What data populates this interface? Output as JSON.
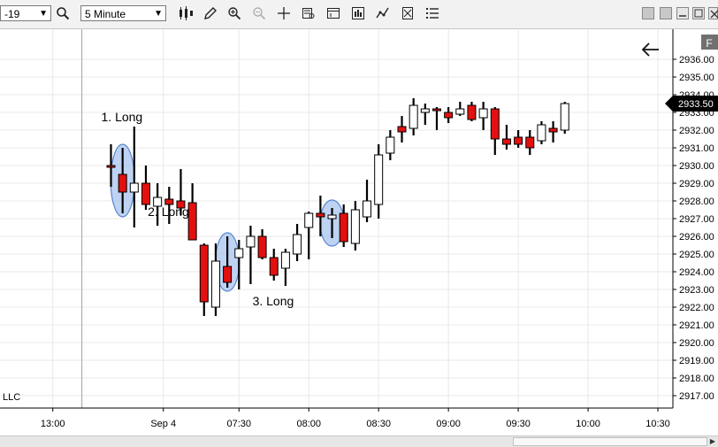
{
  "toolbar": {
    "instrument_value": "-19",
    "interval_value": "5 Minute",
    "icons": [
      "search-icon",
      "bar-type-icon",
      "pencil-icon",
      "zoom-in-icon",
      "zoom-out-icon",
      "crosshair-icon",
      "data-box-icon",
      "chart-properties-icon",
      "strategies-icon",
      "indicators-icon",
      "drawing-tools-icon",
      "list-icon"
    ]
  },
  "panel_label": "F",
  "corner_text": "LLC",
  "price_marker": "2933.50",
  "annotations": [
    {
      "text": "1. Long",
      "bar": 0,
      "price": 2932.5
    },
    {
      "text": "2. Long",
      "bar": 4,
      "price": 2927.15
    },
    {
      "text": "3. Long",
      "bar": 13,
      "price": 2922.1
    }
  ],
  "highlight_bars": [
    1,
    10,
    19
  ],
  "chart_data": {
    "type": "candlestick",
    "y_ticks": [
      "2917.00",
      "2918.00",
      "2919.00",
      "2920.00",
      "2921.00",
      "2922.00",
      "2923.00",
      "2924.00",
      "2925.00",
      "2926.00",
      "2927.00",
      "2928.00",
      "2929.00",
      "2930.00",
      "2931.00",
      "2932.00",
      "2933.00",
      "2934.00",
      "2935.00",
      "2936.00"
    ],
    "ylim": [
      2916.3,
      2937.7
    ],
    "x_ticks": [
      {
        "label": "13:00",
        "bar": -5
      },
      {
        "label": "Sep 4",
        "bar": 4.5
      },
      {
        "label": "07:30",
        "bar": 11
      },
      {
        "label": "08:00",
        "bar": 17
      },
      {
        "label": "08:30",
        "bar": 23
      },
      {
        "label": "09:00",
        "bar": 29
      },
      {
        "label": "09:30",
        "bar": 35
      },
      {
        "label": "10:00",
        "bar": 41
      },
      {
        "label": "10:30",
        "bar": 47
      }
    ],
    "session_break_bar": -2.5,
    "candles": [
      {
        "o": 2930.0,
        "h": 2931.2,
        "l": 2928.8,
        "c": 2929.9
      },
      {
        "o": 2929.5,
        "h": 2931.0,
        "l": 2927.3,
        "c": 2928.5
      },
      {
        "o": 2928.5,
        "h": 2932.2,
        "l": 2926.5,
        "c": 2929.0
      },
      {
        "o": 2929.0,
        "h": 2930.0,
        "l": 2927.5,
        "c": 2927.8
      },
      {
        "o": 2927.7,
        "h": 2929.0,
        "l": 2926.6,
        "c": 2928.2
      },
      {
        "o": 2928.1,
        "h": 2928.8,
        "l": 2926.7,
        "c": 2927.8
      },
      {
        "o": 2928.0,
        "h": 2929.8,
        "l": 2927.2,
        "c": 2927.6
      },
      {
        "o": 2927.9,
        "h": 2929.0,
        "l": 2926.3,
        "c": 2925.8
      },
      {
        "o": 2925.5,
        "h": 2925.6,
        "l": 2921.5,
        "c": 2922.3
      },
      {
        "o": 2922.0,
        "h": 2925.6,
        "l": 2921.5,
        "c": 2924.6
      },
      {
        "o": 2924.3,
        "h": 2926.0,
        "l": 2923.1,
        "c": 2923.4
      },
      {
        "o": 2924.8,
        "h": 2925.8,
        "l": 2923.0,
        "c": 2925.3
      },
      {
        "o": 2925.4,
        "h": 2926.6,
        "l": 2923.3,
        "c": 2926.0
      },
      {
        "o": 2926.0,
        "h": 2926.4,
        "l": 2924.7,
        "c": 2924.8
      },
      {
        "o": 2924.8,
        "h": 2925.3,
        "l": 2923.5,
        "c": 2923.8
      },
      {
        "o": 2924.2,
        "h": 2925.3,
        "l": 2923.2,
        "c": 2925.1
      },
      {
        "o": 2925.0,
        "h": 2926.7,
        "l": 2924.6,
        "c": 2926.1
      },
      {
        "o": 2926.5,
        "h": 2927.4,
        "l": 2924.7,
        "c": 2927.3
      },
      {
        "o": 2927.3,
        "h": 2928.3,
        "l": 2926.0,
        "c": 2927.1
      },
      {
        "o": 2927.0,
        "h": 2927.6,
        "l": 2925.9,
        "c": 2927.2
      },
      {
        "o": 2927.3,
        "h": 2927.8,
        "l": 2925.4,
        "c": 2925.7
      },
      {
        "o": 2925.6,
        "h": 2928.0,
        "l": 2925.2,
        "c": 2927.5
      },
      {
        "o": 2927.1,
        "h": 2929.2,
        "l": 2926.8,
        "c": 2928.0
      },
      {
        "o": 2927.8,
        "h": 2931.2,
        "l": 2927.0,
        "c": 2930.6
      },
      {
        "o": 2930.7,
        "h": 2932.0,
        "l": 2930.3,
        "c": 2931.6
      },
      {
        "o": 2932.2,
        "h": 2932.8,
        "l": 2931.3,
        "c": 2931.9
      },
      {
        "o": 2932.1,
        "h": 2933.8,
        "l": 2931.7,
        "c": 2933.4
      },
      {
        "o": 2933.0,
        "h": 2933.5,
        "l": 2932.3,
        "c": 2933.2
      },
      {
        "o": 2933.2,
        "h": 2933.3,
        "l": 2932.0,
        "c": 2933.1
      },
      {
        "o": 2933.0,
        "h": 2933.3,
        "l": 2932.4,
        "c": 2932.7
      },
      {
        "o": 2932.9,
        "h": 2933.6,
        "l": 2932.8,
        "c": 2933.2
      },
      {
        "o": 2933.4,
        "h": 2933.6,
        "l": 2932.5,
        "c": 2932.6
      },
      {
        "o": 2932.7,
        "h": 2933.6,
        "l": 2932.0,
        "c": 2933.2
      },
      {
        "o": 2933.2,
        "h": 2933.3,
        "l": 2930.6,
        "c": 2931.5
      },
      {
        "o": 2931.5,
        "h": 2932.3,
        "l": 2930.9,
        "c": 2931.2
      },
      {
        "o": 2931.6,
        "h": 2932.0,
        "l": 2931.0,
        "c": 2931.2
      },
      {
        "o": 2931.6,
        "h": 2932.0,
        "l": 2930.6,
        "c": 2931.0
      },
      {
        "o": 2931.4,
        "h": 2932.5,
        "l": 2931.2,
        "c": 2932.3
      },
      {
        "o": 2932.1,
        "h": 2932.5,
        "l": 2931.3,
        "c": 2931.9
      },
      {
        "o": 2932.0,
        "h": 2933.6,
        "l": 2931.8,
        "c": 2933.5
      }
    ]
  }
}
